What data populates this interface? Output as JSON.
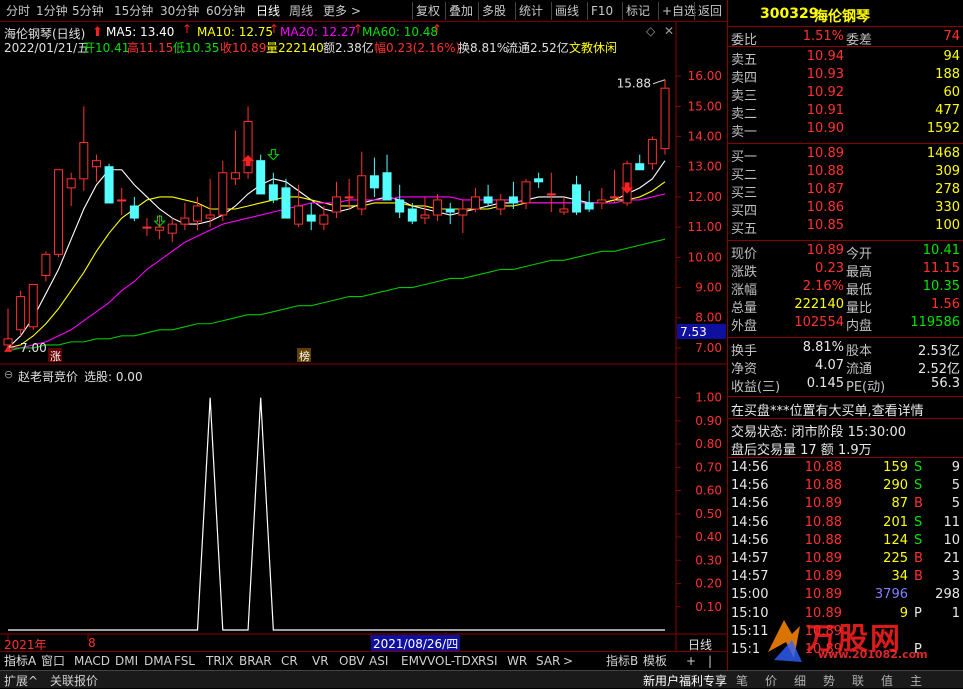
{
  "toolbar": {
    "periods": [
      "分时",
      "1分钟",
      "5分钟",
      "15分钟",
      "30分钟",
      "60分钟",
      "日线",
      "周线",
      "更多 >"
    ],
    "active_period": "日线",
    "buttons": [
      "复权",
      "叠加",
      "多股",
      "统计",
      "画线",
      "F10",
      "标记",
      "+自选",
      "返回"
    ]
  },
  "chart": {
    "title": "海伦钢琴(日线)",
    "ma5": "MA5: 13.40",
    "ma10": "MA10: 12.75",
    "ma20": "MA20: 12.27",
    "ma60": "MA60: 10.48",
    "date_line": {
      "date": "2022/01/21/五",
      "open": "开10.41",
      "high": "高11.15",
      "low": "低10.35",
      "close": "收10.89",
      "volume": "量222140",
      "amount": "额2.38亿",
      "change": "幅0.23(2.16%)",
      "turnover": "换8.81%",
      "float": "流通2.52亿",
      "sector": "文教休闲"
    },
    "max_label": "15.88",
    "min_label": "7.00",
    "price_tag": "7.53",
    "y_ticks": [
      "16.00",
      "15.00",
      "14.00",
      "13.00",
      "12.00",
      "11.00",
      "10.00",
      "9.00",
      "8.00",
      "7.00"
    ],
    "markers": {
      "zhang": "涨",
      "bang": "榜"
    }
  },
  "chart_data": [
    {
      "type": "candlestick",
      "title": "海伦钢琴(日线)",
      "ylim": [
        6.6,
        16.6
      ],
      "candles": [
        {
          "o": 7.1,
          "h": 8.3,
          "l": 7.0,
          "c": 7.3
        },
        {
          "o": 7.6,
          "h": 8.9,
          "l": 7.4,
          "c": 8.7
        },
        {
          "o": 7.7,
          "h": 9.1,
          "l": 7.6,
          "c": 9.1
        },
        {
          "o": 9.4,
          "h": 10.2,
          "l": 9.2,
          "c": 10.1
        },
        {
          "o": 10.1,
          "h": 12.9,
          "l": 10.0,
          "c": 12.9
        },
        {
          "o": 12.3,
          "h": 12.8,
          "l": 11.7,
          "c": 12.6
        },
        {
          "o": 12.6,
          "h": 15.0,
          "l": 12.2,
          "c": 13.8
        },
        {
          "o": 13.0,
          "h": 13.4,
          "l": 12.5,
          "c": 13.2
        },
        {
          "o": 13.0,
          "h": 13.1,
          "l": 11.8,
          "c": 11.8
        },
        {
          "o": 11.9,
          "h": 12.3,
          "l": 11.4,
          "c": 11.9
        },
        {
          "o": 11.7,
          "h": 12.0,
          "l": 11.2,
          "c": 11.3
        },
        {
          "o": 11.0,
          "h": 11.3,
          "l": 10.7,
          "c": 11.0
        },
        {
          "o": 10.9,
          "h": 11.4,
          "l": 10.6,
          "c": 11.0
        },
        {
          "o": 10.8,
          "h": 11.3,
          "l": 10.5,
          "c": 11.1
        },
        {
          "o": 11.1,
          "h": 11.8,
          "l": 10.9,
          "c": 11.3
        },
        {
          "o": 11.2,
          "h": 12.0,
          "l": 10.9,
          "c": 11.7
        },
        {
          "o": 11.3,
          "h": 12.6,
          "l": 11.0,
          "c": 11.4
        },
        {
          "o": 11.4,
          "h": 13.2,
          "l": 11.2,
          "c": 12.8
        },
        {
          "o": 12.6,
          "h": 14.2,
          "l": 12.4,
          "c": 12.8
        },
        {
          "o": 12.8,
          "h": 15.0,
          "l": 12.6,
          "c": 14.5
        },
        {
          "o": 13.2,
          "h": 13.4,
          "l": 12.1,
          "c": 12.1
        },
        {
          "o": 12.4,
          "h": 12.8,
          "l": 11.8,
          "c": 11.9
        },
        {
          "o": 12.3,
          "h": 12.6,
          "l": 11.3,
          "c": 11.3
        },
        {
          "o": 11.1,
          "h": 12.4,
          "l": 11.0,
          "c": 11.7
        },
        {
          "o": 11.4,
          "h": 11.8,
          "l": 10.9,
          "c": 11.2
        },
        {
          "o": 11.1,
          "h": 11.7,
          "l": 10.9,
          "c": 11.4
        },
        {
          "o": 11.5,
          "h": 12.5,
          "l": 11.3,
          "c": 12.0
        },
        {
          "o": 12.0,
          "h": 12.6,
          "l": 11.6,
          "c": 12.0
        },
        {
          "o": 11.6,
          "h": 13.5,
          "l": 11.4,
          "c": 12.7
        },
        {
          "o": 12.7,
          "h": 13.3,
          "l": 12.0,
          "c": 12.3
        },
        {
          "o": 12.8,
          "h": 13.4,
          "l": 11.9,
          "c": 11.9
        },
        {
          "o": 11.9,
          "h": 12.4,
          "l": 11.3,
          "c": 11.5
        },
        {
          "o": 11.6,
          "h": 11.8,
          "l": 11.1,
          "c": 11.2
        },
        {
          "o": 11.3,
          "h": 12.0,
          "l": 11.1,
          "c": 11.4
        },
        {
          "o": 11.4,
          "h": 12.1,
          "l": 11.2,
          "c": 11.9
        },
        {
          "o": 11.6,
          "h": 11.8,
          "l": 11.1,
          "c": 11.5
        },
        {
          "o": 11.4,
          "h": 11.9,
          "l": 10.8,
          "c": 11.6
        },
        {
          "o": 11.6,
          "h": 12.3,
          "l": 11.5,
          "c": 12.0
        },
        {
          "o": 12.0,
          "h": 12.4,
          "l": 11.7,
          "c": 11.8
        },
        {
          "o": 11.6,
          "h": 12.1,
          "l": 11.4,
          "c": 11.9
        },
        {
          "o": 12.0,
          "h": 12.5,
          "l": 11.6,
          "c": 11.8
        },
        {
          "o": 11.8,
          "h": 12.6,
          "l": 11.6,
          "c": 12.5
        },
        {
          "o": 12.6,
          "h": 12.8,
          "l": 12.3,
          "c": 12.5
        },
        {
          "o": 12.1,
          "h": 12.8,
          "l": 11.5,
          "c": 12.1
        },
        {
          "o": 11.5,
          "h": 12.0,
          "l": 11.4,
          "c": 11.6
        },
        {
          "o": 12.4,
          "h": 12.7,
          "l": 11.4,
          "c": 11.5
        },
        {
          "o": 11.8,
          "h": 12.2,
          "l": 11.5,
          "c": 11.6
        },
        {
          "o": 11.8,
          "h": 12.3,
          "l": 11.6,
          "c": 11.9
        },
        {
          "o": 12.0,
          "h": 12.9,
          "l": 11.8,
          "c": 12.0
        },
        {
          "o": 11.8,
          "h": 13.2,
          "l": 11.7,
          "c": 13.1
        },
        {
          "o": 13.1,
          "h": 13.4,
          "l": 12.9,
          "c": 12.9
        },
        {
          "o": 13.1,
          "h": 14.0,
          "l": 12.9,
          "c": 13.9
        },
        {
          "o": 13.6,
          "h": 15.88,
          "l": 13.4,
          "c": 15.6
        }
      ],
      "ma_series": [
        {
          "name": "MA5",
          "color": "#ffffff",
          "values": [
            7.0,
            7.4,
            8.0,
            8.8,
            9.6,
            10.6,
            11.6,
            12.4,
            12.9,
            12.9,
            12.4,
            12.0,
            11.6,
            11.3,
            11.1,
            11.1,
            11.2,
            11.4,
            11.7,
            12.1,
            12.4,
            12.6,
            12.5,
            12.2,
            11.9,
            11.6,
            11.5,
            11.6,
            11.8,
            11.9,
            12.0,
            11.9,
            11.7,
            11.6,
            11.5,
            11.4,
            11.5,
            11.6,
            11.7,
            11.8,
            11.8,
            11.9,
            12.0,
            12.0,
            12.0,
            11.9,
            11.8,
            11.8,
            11.9,
            12.1,
            12.3,
            12.6,
            13.2
          ]
        },
        {
          "name": "MA10",
          "color": "#ffff00",
          "values": [
            7.0,
            7.1,
            7.4,
            7.8,
            8.3,
            8.9,
            9.5,
            10.2,
            10.8,
            11.3,
            11.6,
            11.9,
            12.0,
            12.0,
            11.9,
            11.8,
            11.6,
            11.6,
            11.6,
            11.7,
            11.8,
            11.9,
            12.0,
            12.0,
            11.9,
            11.8,
            11.7,
            11.7,
            11.7,
            11.8,
            11.8,
            11.8,
            11.7,
            11.7,
            11.6,
            11.6,
            11.6,
            11.6,
            11.6,
            11.7,
            11.7,
            11.8,
            11.8,
            11.8,
            11.8,
            11.8,
            11.8,
            11.8,
            11.9,
            11.9,
            12.0,
            12.2,
            12.5
          ]
        },
        {
          "name": "MA20",
          "color": "#ff00ff",
          "values": [
            7.0,
            7.0,
            7.1,
            7.2,
            7.4,
            7.6,
            7.9,
            8.2,
            8.5,
            8.9,
            9.2,
            9.6,
            9.9,
            10.2,
            10.5,
            10.7,
            10.9,
            11.1,
            11.2,
            11.3,
            11.4,
            11.5,
            11.6,
            11.7,
            11.8,
            11.8,
            11.8,
            11.9,
            11.9,
            11.9,
            11.9,
            12.0,
            12.0,
            12.0,
            12.0,
            12.0,
            11.9,
            11.9,
            11.9,
            11.9,
            11.9,
            11.8,
            11.8,
            11.8,
            11.8,
            11.8,
            11.8,
            11.8,
            11.8,
            11.9,
            11.9,
            12.0,
            12.1
          ]
        },
        {
          "name": "MA60",
          "color": "#00c800",
          "values": [
            6.9,
            7.0,
            7.0,
            7.1,
            7.1,
            7.2,
            7.2,
            7.3,
            7.3,
            7.4,
            7.4,
            7.5,
            7.6,
            7.6,
            7.7,
            7.8,
            7.8,
            7.9,
            8.0,
            8.1,
            8.1,
            8.2,
            8.3,
            8.4,
            8.4,
            8.5,
            8.6,
            8.7,
            8.7,
            8.8,
            8.9,
            9.0,
            9.0,
            9.1,
            9.2,
            9.3,
            9.3,
            9.4,
            9.5,
            9.6,
            9.6,
            9.7,
            9.8,
            9.9,
            9.9,
            10.0,
            10.1,
            10.2,
            10.2,
            10.3,
            10.4,
            10.5,
            10.6
          ]
        }
      ]
    },
    {
      "type": "line",
      "title": "赵老哥竞价 选股: 0.00",
      "ylim": [
        0,
        1.05
      ],
      "y_ticks": [
        "1.00",
        "0.90",
        "0.80",
        "0.70",
        "0.60",
        "0.50",
        "0.40",
        "0.30",
        "0.20",
        "0.10"
      ],
      "values": [
        0,
        0,
        0,
        0,
        0,
        0,
        0,
        0,
        0,
        0,
        0,
        0,
        0,
        0,
        0,
        0,
        1,
        0,
        0,
        0,
        1,
        0,
        0,
        0,
        0,
        0,
        0,
        0,
        0,
        0,
        0,
        0,
        0,
        0,
        0,
        0,
        0,
        0,
        0,
        0,
        0,
        0,
        0,
        0,
        0,
        0,
        0,
        0,
        0,
        0,
        0,
        0,
        0
      ]
    }
  ],
  "indicator": {
    "name": "赵老哥竞价",
    "value": "选股: 0.00"
  },
  "axis_bottom": {
    "year": "2021年",
    "month": "8",
    "highlight_date": "2021/08/26/四",
    "period": "日线"
  },
  "tabs": {
    "left_label": "指标A",
    "items": [
      "窗口",
      "MACD",
      "DMI",
      "DMA",
      "FSL",
      "TRIX",
      "BRAR",
      "CR",
      "VR",
      "OBV",
      "ASI",
      "EMV",
      "VOL-TDX",
      "RSI",
      "WR",
      "SAR",
      ">"
    ],
    "right_items": [
      "指标B",
      "模板",
      "+",
      "|"
    ]
  },
  "status": {
    "left1": "扩展^",
    "left2": "关联报价",
    "right": "新用户福利专享",
    "icons": [
      "笔",
      "价",
      "细",
      "势",
      "联",
      "值",
      "主"
    ]
  },
  "quote": {
    "code": "300329",
    "name": "海伦钢琴",
    "weibi_label": "委比",
    "weibi": "1.51%",
    "weicha_label": "委差",
    "weicha": "74",
    "asks": [
      {
        "label": "卖五",
        "price": "10.94",
        "vol": "94"
      },
      {
        "label": "卖四",
        "price": "10.93",
        "vol": "188"
      },
      {
        "label": "卖三",
        "price": "10.92",
        "vol": "60"
      },
      {
        "label": "卖二",
        "price": "10.91",
        "vol": "477"
      },
      {
        "label": "卖一",
        "price": "10.90",
        "vol": "1592"
      }
    ],
    "bids": [
      {
        "label": "买一",
        "price": "10.89",
        "vol": "1468"
      },
      {
        "label": "买二",
        "price": "10.88",
        "vol": "309"
      },
      {
        "label": "买三",
        "price": "10.87",
        "vol": "278"
      },
      {
        "label": "买四",
        "price": "10.86",
        "vol": "330"
      },
      {
        "label": "买五",
        "price": "10.85",
        "vol": "100"
      }
    ],
    "stats": [
      {
        "l1": "现价",
        "v1": "10.89",
        "l2": "今开",
        "v2": "10.41"
      },
      {
        "l1": "涨跌",
        "v1": "0.23",
        "l2": "最高",
        "v2": "11.15"
      },
      {
        "l1": "涨幅",
        "v1": "2.16%",
        "l2": "最低",
        "v2": "10.35"
      },
      {
        "l1": "总量",
        "v1": "222140",
        "l2": "量比",
        "v2": "1.56"
      },
      {
        "l1": "外盘",
        "v1": "102554",
        "l2": "内盘",
        "v2": "119586"
      }
    ],
    "stats2": [
      {
        "l1": "换手",
        "v1": "8.81%",
        "l2": "股本",
        "v2": "2.53亿"
      },
      {
        "l1": "净资",
        "v1": "4.07",
        "l2": "流通",
        "v2": "2.52亿"
      },
      {
        "l1": "收益(三)",
        "v1": "0.145",
        "l2": "PE(动)",
        "v2": "56.3"
      }
    ],
    "notice": "在买盘***位置有大买单,查看详情",
    "trade_state": "交易状态: 闭市阶段 15:30:00",
    "after_hours": "盘后交易量 17 额 1.9万",
    "ticks": [
      {
        "t": "14:56",
        "p": "10.88",
        "v": "159",
        "bs": "S",
        "n": "9"
      },
      {
        "t": "14:56",
        "p": "10.88",
        "v": "290",
        "bs": "S",
        "n": "5"
      },
      {
        "t": "14:56",
        "p": "10.89",
        "v": "87",
        "bs": "B",
        "n": "5"
      },
      {
        "t": "14:56",
        "p": "10.88",
        "v": "201",
        "bs": "S",
        "n": "11"
      },
      {
        "t": "14:56",
        "p": "10.88",
        "v": "124",
        "bs": "S",
        "n": "10"
      },
      {
        "t": "14:57",
        "p": "10.89",
        "v": "225",
        "bs": "B",
        "n": "21"
      },
      {
        "t": "14:57",
        "p": "10.89",
        "v": "34",
        "bs": "B",
        "n": "3"
      },
      {
        "t": "15:00",
        "p": "10.89",
        "v": "3796",
        "bs": "",
        "n": "298"
      },
      {
        "t": "15:10",
        "p": "10.89",
        "v": "9",
        "bs": "P",
        "n": "1"
      },
      {
        "t": "15:11",
        "p": "10.89",
        "v": "",
        "bs": "",
        "n": ""
      },
      {
        "t": "15:1",
        "p": "10.89",
        "v": "",
        "bs": "P",
        "n": ""
      }
    ]
  },
  "watermark": {
    "text": "万股网",
    "url": "www.201082.com"
  },
  "colors": {
    "up": "#ff3232",
    "down": "#54ffff",
    "border": "#8a0000",
    "ma5": "#ffffff",
    "ma10": "#ffff00",
    "ma20": "#ff00ff",
    "ma60": "#00c800"
  }
}
